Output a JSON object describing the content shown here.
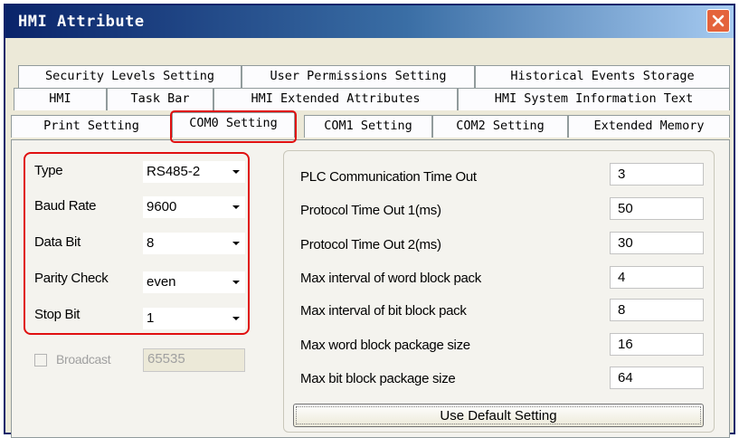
{
  "window": {
    "title": "HMI Attribute",
    "close_icon": "close-icon"
  },
  "tabs": {
    "row1": [
      "Security Levels Setting",
      "User Permissions Setting",
      "Historical Events Storage"
    ],
    "row2": [
      "HMI",
      "Task Bar",
      "HMI Extended Attributes",
      "HMI System Information Text"
    ],
    "row3": [
      "Print Setting",
      "COM0 Setting",
      "COM1 Setting",
      "COM2 Setting",
      "Extended Memory"
    ],
    "active": "COM0 Setting"
  },
  "com_settings": [
    {
      "label": "Type",
      "value": "RS485-2"
    },
    {
      "label": "Baud Rate",
      "value": "9600"
    },
    {
      "label": "Data Bit",
      "value": "8"
    },
    {
      "label": "Parity Check",
      "value": "even"
    },
    {
      "label": "Stop Bit",
      "value": "1"
    }
  ],
  "broadcast": {
    "label": "Broadcast",
    "checked": false,
    "value": "65535",
    "enabled": false
  },
  "timeouts": [
    {
      "label": "PLC Communication Time Out",
      "value": "3"
    },
    {
      "label": "Protocol Time Out 1(ms)",
      "value": "50"
    },
    {
      "label": "Protocol Time Out 2(ms)",
      "value": "30"
    },
    {
      "label": "Max interval of word block pack",
      "value": "4"
    },
    {
      "label": "Max interval of bit block pack",
      "value": "8"
    },
    {
      "label": "Max word block package size",
      "value": "16"
    },
    {
      "label": "Max bit block package size",
      "value": "64"
    }
  ],
  "default_button": "Use Default Setting",
  "colors": {
    "highlight": "#e01010",
    "titlebar": "#0a246a",
    "dialog_bg": "#ece9d8"
  }
}
